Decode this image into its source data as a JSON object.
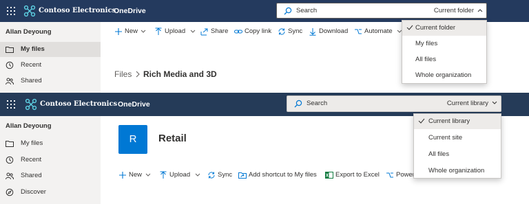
{
  "colors": {
    "suite_bar_top": "#243a5e",
    "suite_bar_bottom": "#253b58",
    "accent": "#0078d4",
    "sidebar_bg": "#f3f2f1"
  },
  "top": {
    "brand": "Contoso Electronics",
    "app": "OneDrive",
    "search": {
      "placeholder": "Search",
      "scope": "Current folder"
    },
    "user": "Allan Deyoung",
    "nav": [
      {
        "label": "My files",
        "icon": "folder-icon",
        "active": true
      },
      {
        "label": "Recent",
        "icon": "recent-icon",
        "active": false
      },
      {
        "label": "Shared",
        "icon": "shared-icon",
        "active": false
      }
    ],
    "commands": [
      {
        "label": "New",
        "icon": "plus-icon"
      },
      {
        "label": "Upload",
        "icon": "upload-icon"
      },
      {
        "label": "Share",
        "icon": "share-icon"
      },
      {
        "label": "Copy link",
        "icon": "link-icon"
      },
      {
        "label": "Sync",
        "icon": "sync-icon"
      },
      {
        "label": "Download",
        "icon": "download-icon"
      },
      {
        "label": "Automate",
        "icon": "automate-icon"
      }
    ],
    "breadcrumb": {
      "root": "Files",
      "current": "Rich Media and 3D"
    },
    "scope_options": [
      {
        "label": "Current folder",
        "selected": true
      },
      {
        "label": "My files",
        "selected": false
      },
      {
        "label": "All files",
        "selected": false
      },
      {
        "label": "Whole organization",
        "selected": false
      }
    ]
  },
  "bottom": {
    "brand": "Contoso Electronics",
    "app": "OneDrive",
    "search": {
      "placeholder": "Search",
      "scope": "Current library"
    },
    "user": "Allan Deyoung",
    "nav": [
      {
        "label": "My files",
        "icon": "folder-icon"
      },
      {
        "label": "Recent",
        "icon": "recent-icon"
      },
      {
        "label": "Shared",
        "icon": "shared-icon"
      },
      {
        "label": "Discover",
        "icon": "discover-icon"
      }
    ],
    "site": {
      "initial": "R",
      "title": "Retail"
    },
    "commands": [
      {
        "label": "New",
        "icon": "plus-icon"
      },
      {
        "label": "Upload",
        "icon": "upload-icon"
      },
      {
        "label": "Sync",
        "icon": "sync-icon"
      },
      {
        "label": "Add shortcut to My files",
        "icon": "shortcut-icon"
      },
      {
        "label": "Export to Excel",
        "icon": "excel-icon"
      },
      {
        "label": "Power",
        "icon": "power-icon"
      }
    ],
    "scope_options": [
      {
        "label": "Current library",
        "selected": true
      },
      {
        "label": "Current site",
        "selected": false
      },
      {
        "label": "All files",
        "selected": false
      },
      {
        "label": "Whole organization",
        "selected": false
      }
    ]
  }
}
